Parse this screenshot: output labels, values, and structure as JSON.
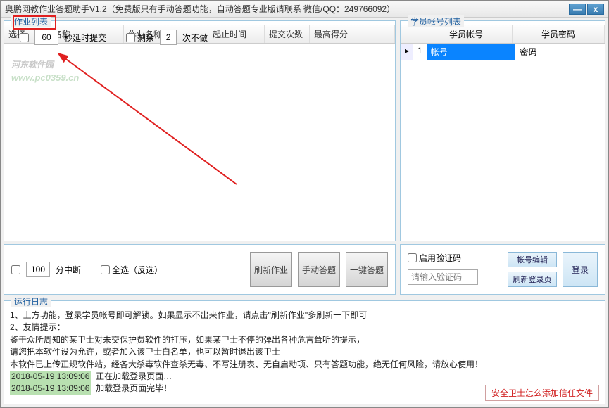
{
  "title": "奥鹏网教作业答题助手V1.2（免费版只有手动答题功能，自动答题专业版请联系  微信/QQ：249766092）",
  "window_buttons": {
    "min": "—",
    "close": "x"
  },
  "hw_group_title": "作业列表",
  "hw_columns": {
    "select": "选择",
    "course": "课程名称",
    "hw_name": "作业名称",
    "deadline": "起止时间",
    "submits": "提交次数",
    "best": "最高得分"
  },
  "controls": {
    "break_num": "100",
    "break_label": "分中断",
    "delay_num": "60",
    "delay_label": "秒延时提交",
    "select_all": "全选（反选）",
    "remain_label": "剩余",
    "remain_num": "2",
    "remain_suffix": "次不做",
    "refresh_hw": "刷新作业",
    "manual": "手动答题",
    "auto": "一键答题"
  },
  "acct_group_title": "学员帐号列表",
  "acct_columns": {
    "idx": "",
    "acct": "学员帐号",
    "pwd": "学员密码"
  },
  "acct_rows": [
    {
      "idx": "1",
      "acct": "帐号",
      "pwd": "密码"
    }
  ],
  "login": {
    "enable_captcha": "启用验证码",
    "captcha_placeholder": "请输入验证码",
    "edit_acct": "帐号编辑",
    "refresh_login": "刷新登录页",
    "login_btn": "登录"
  },
  "log_group_title": "运行日志",
  "log_lines": {
    "l1": "1、上方功能，登录学员帐号即可解锁。如果显示不出来作业，请点击\"刷新作业\"多刷新一下即可",
    "l2": "2、友情提示：",
    "l3": "鉴于众所周知的某卫士对未交保护费软件的打压，如果某卫士不停的弹出各种危言耸听的提示，",
    "l4": "请您把本软件设为允许，或者加入该卫士白名单，也可以暂时退出该卫士",
    "l5": "本软件已上传正规软件站，经各大杀毒软件查杀无毒、不写注册表、无自启动项、只有答题功能，绝无任何风险，请放心使用！",
    "ts1": "2018-05-19 13:09:06",
    "msg1": "正在加载登录页面…",
    "ts2": "2018-05-19 13:09:06",
    "msg2": "加载登录页面完毕！"
  },
  "footer_link": "安全卫士怎么添加信任文件",
  "watermark": {
    "main": "河东软件园",
    "sub": "www.pc0359.cn"
  }
}
